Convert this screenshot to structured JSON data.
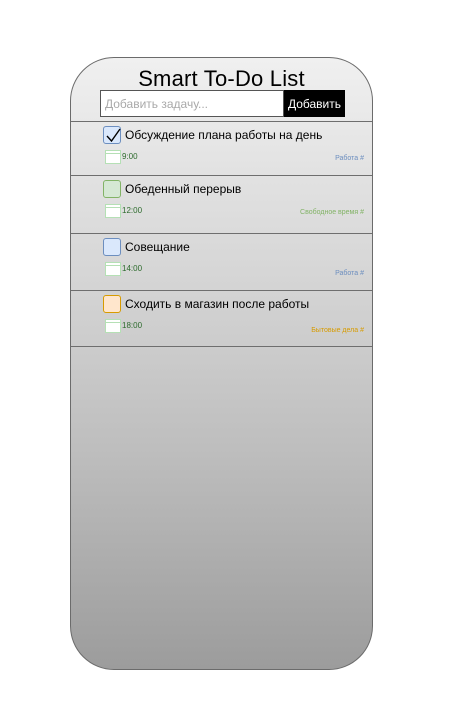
{
  "app": {
    "title": "Smart To-Do List"
  },
  "add_form": {
    "placeholder": "Добавить задачу...",
    "button_label": "Добавить"
  },
  "tasks": [
    {
      "text": "Обсуждение плана работы на день",
      "time": "9:00",
      "tag": "Работа #",
      "checked": true,
      "checkbox_color": "#dae8fc",
      "checkbox_border": "#6c8ebf",
      "tag_color": "#6c8ebf",
      "time_color": "#2d6b2d"
    },
    {
      "text": "Обеденный перерыв",
      "time": "12:00",
      "tag": "Свободное время #",
      "checked": false,
      "checkbox_color": "#d5e8d4",
      "checkbox_border": "#82b366",
      "tag_color": "#82b366",
      "time_color": "#2d6b2d"
    },
    {
      "text": "Совещание",
      "time": "14:00",
      "tag": "Работа #",
      "checked": false,
      "checkbox_color": "#dae8fc",
      "checkbox_border": "#6c8ebf",
      "tag_color": "#6c8ebf",
      "time_color": "#2d6b2d"
    },
    {
      "text": "Сходить в магазин после работы",
      "time": "18:00",
      "tag": "Бытовые дела #",
      "checked": false,
      "checkbox_color": "#ffe6cc",
      "checkbox_border": "#d79b00",
      "tag_color": "#d79b00",
      "time_color": "#2d6b2d"
    }
  ],
  "icons": {
    "checkbox": "checkbox-icon",
    "checkmark": "checkmark-icon",
    "calendar": "calendar-icon"
  }
}
